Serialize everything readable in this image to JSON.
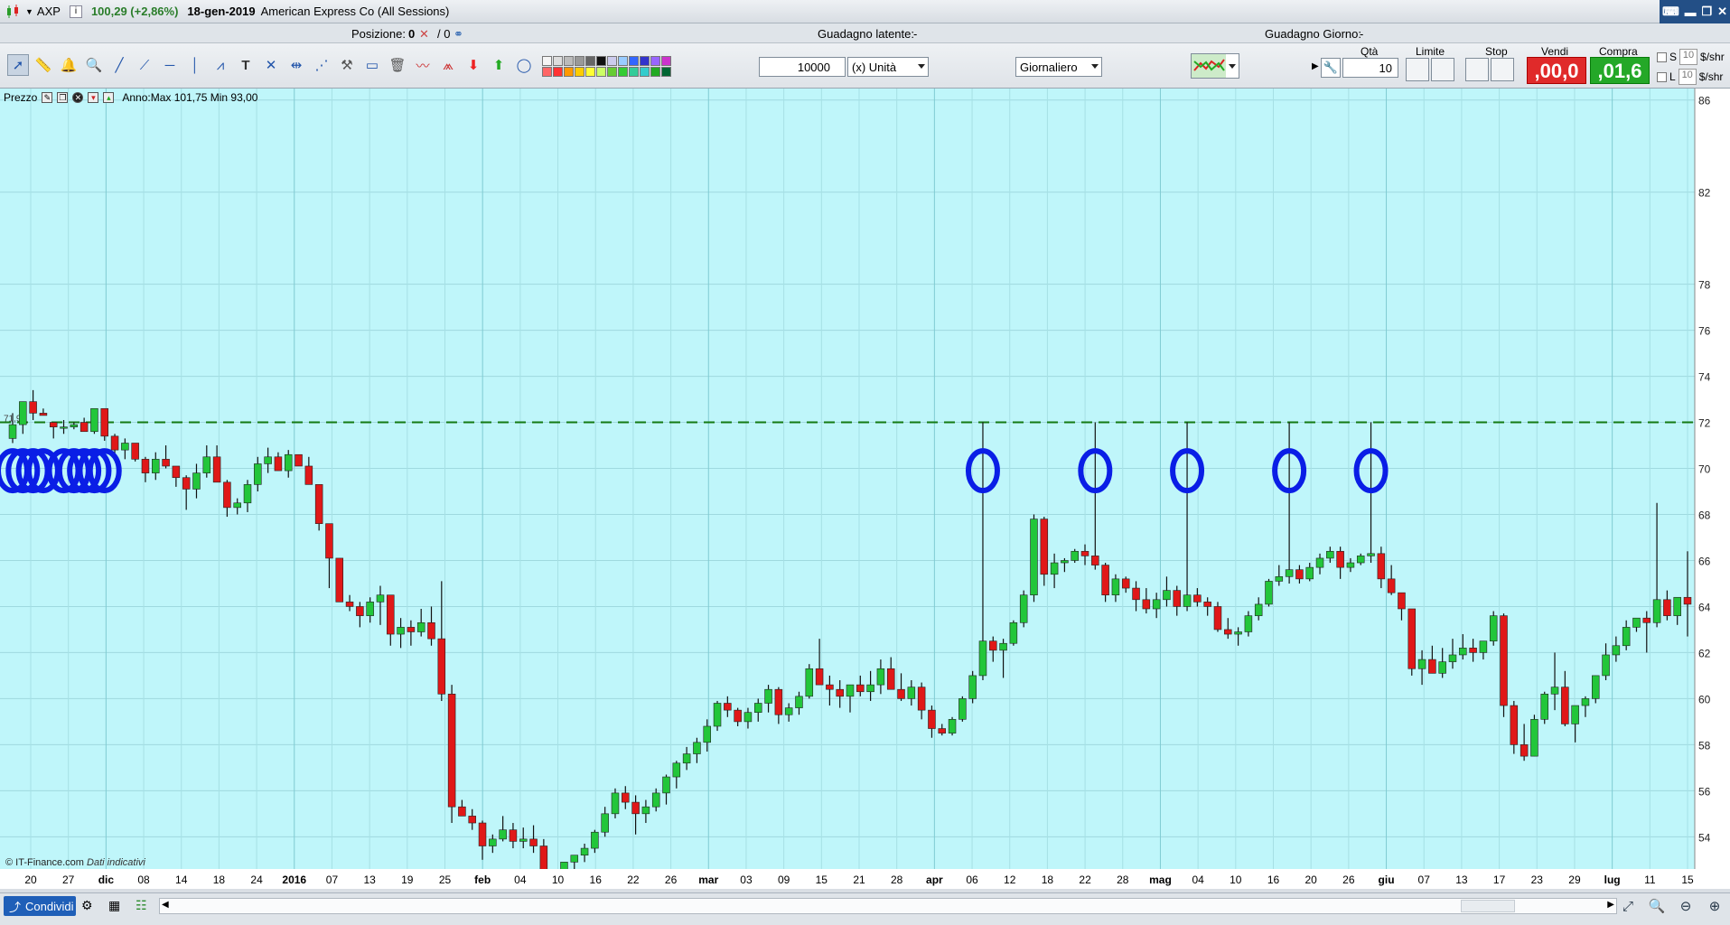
{
  "titlebar": {
    "symbol": "AXP",
    "info": "i",
    "price": "100,29 (+2,86%)",
    "date": "18-gen-2019",
    "name": "American Express Co (All Sessions)"
  },
  "status": {
    "position_label": "Posizione:",
    "position_value": "0",
    "position_ratio": "/ 0",
    "latent_label": "Guadagno latente:",
    "latent_value": "-",
    "day_label": "Guadagno Giorno:",
    "day_value": "-"
  },
  "toolbar": {
    "quantity": "10000",
    "unit": "(x) Unità",
    "period": "Giornaliero"
  },
  "trade": {
    "qty_label": "Qtà",
    "qty_value": "10",
    "limit_label": "Limite",
    "stop_label": "Stop",
    "sell_label": "Vendi",
    "sell_price": ",00,0",
    "buy_label": "Compra",
    "buy_price": ",01,6",
    "s_label": "S",
    "l_label": "L",
    "s_value": "10",
    "l_value": "10",
    "unit_s": "$/shr",
    "unit_l": "$/shr"
  },
  "chart_header": {
    "label": "Prezzo",
    "stats": "Anno:Max 101,75 Min 93,00",
    "level_tag": "71,97"
  },
  "footer": {
    "copyright": "© IT-Finance.com",
    "note": "Dati indicativi",
    "share": "Condividi"
  },
  "colors": {
    "background": "#bff6fa",
    "up": "#22c63a",
    "down": "#e01818",
    "annotation": "#0a1ee6",
    "resistance": "#137a13"
  },
  "chart_data": {
    "type": "candlestick",
    "ylim": [
      52.6,
      86.5
    ],
    "yticks": [
      86,
      82,
      78,
      76,
      74,
      72,
      70,
      68,
      66,
      64,
      62,
      60,
      58,
      56,
      54
    ],
    "x_labels": [
      "20",
      "27",
      "dic",
      "08",
      "14",
      "18",
      "24",
      "2016",
      "07",
      "13",
      "19",
      "25",
      "feb",
      "04",
      "10",
      "16",
      "22",
      "26",
      "mar",
      "03",
      "09",
      "15",
      "21",
      "28",
      "apr",
      "06",
      "12",
      "18",
      "22",
      "28",
      "mag",
      "04",
      "10",
      "16",
      "20",
      "26",
      "giu",
      "07",
      "13",
      "17",
      "23",
      "29",
      "lug",
      "11",
      "15"
    ],
    "resistance_level": 72,
    "annotations": "blue hand-drawn circles marking wicks that touch resistance",
    "candles": [
      [
        71.3,
        72.4,
        71.1,
        71.9
      ],
      [
        71.9,
        72.8,
        71.5,
        72.9
      ],
      [
        72.9,
        73.4,
        72.1,
        72.4
      ],
      [
        72.4,
        72.6,
        72.3,
        72.3
      ],
      [
        72.0,
        71.9,
        71.3,
        71.8
      ],
      [
        71.8,
        72.1,
        71.5,
        71.8
      ],
      [
        71.8,
        72.0,
        71.7,
        71.9
      ],
      [
        72.0,
        72.2,
        71.8,
        71.6
      ],
      [
        71.6,
        72.5,
        71.5,
        72.6
      ],
      [
        72.6,
        72.6,
        71.2,
        71.4
      ],
      [
        71.4,
        71.5,
        70.4,
        70.8
      ],
      [
        70.8,
        71.3,
        70.4,
        71.1
      ],
      [
        71.1,
        71.1,
        70.3,
        70.4
      ],
      [
        70.4,
        70.5,
        69.4,
        69.8
      ],
      [
        69.8,
        70.7,
        69.5,
        70.4
      ],
      [
        70.4,
        71.0,
        70.0,
        70.1
      ],
      [
        70.1,
        70.1,
        69.2,
        69.6
      ],
      [
        69.6,
        69.7,
        68.2,
        69.1
      ],
      [
        69.1,
        70.2,
        68.7,
        69.8
      ],
      [
        69.8,
        71.0,
        69.6,
        70.5
      ],
      [
        70.5,
        71.0,
        69.6,
        69.4
      ],
      [
        69.4,
        69.5,
        67.9,
        68.3
      ],
      [
        68.3,
        68.7,
        68.0,
        68.5
      ],
      [
        68.5,
        69.5,
        68.1,
        69.3
      ],
      [
        69.3,
        70.5,
        69.0,
        70.2
      ],
      [
        70.2,
        70.9,
        69.8,
        70.5
      ],
      [
        70.5,
        70.7,
        69.9,
        69.9
      ],
      [
        69.9,
        70.8,
        69.6,
        70.6
      ],
      [
        70.6,
        70.6,
        70.2,
        70.1
      ],
      [
        70.1,
        70.5,
        69.8,
        69.3
      ],
      [
        69.3,
        69.3,
        67.3,
        67.6
      ],
      [
        67.6,
        67.4,
        64.8,
        66.1
      ],
      [
        66.1,
        66.1,
        64.5,
        64.2
      ],
      [
        64.2,
        64.5,
        63.8,
        64.0
      ],
      [
        64.0,
        64.2,
        63.1,
        63.6
      ],
      [
        63.6,
        64.4,
        63.3,
        64.2
      ],
      [
        64.2,
        64.9,
        63.2,
        64.5
      ],
      [
        64.5,
        64.4,
        62.3,
        62.8
      ],
      [
        62.8,
        63.5,
        62.2,
        63.1
      ],
      [
        63.1,
        63.4,
        62.3,
        62.9
      ],
      [
        62.9,
        63.9,
        62.7,
        63.3
      ],
      [
        63.3,
        64.0,
        62.3,
        62.6
      ],
      [
        62.6,
        65.1,
        59.9,
        60.2
      ],
      [
        60.2,
        60.6,
        54.6,
        55.3
      ],
      [
        55.3,
        55.6,
        55.0,
        54.9
      ],
      [
        54.9,
        55.2,
        54.3,
        54.6
      ],
      [
        54.6,
        54.7,
        53.0,
        53.6
      ],
      [
        53.6,
        54.1,
        53.3,
        53.9
      ],
      [
        53.9,
        54.9,
        53.8,
        54.3
      ],
      [
        54.3,
        54.6,
        53.5,
        53.8
      ],
      [
        53.8,
        54.4,
        53.5,
        53.9
      ],
      [
        53.9,
        54.5,
        53.3,
        53.6
      ],
      [
        53.6,
        53.9,
        51.9,
        52.4
      ],
      [
        52.4,
        52.6,
        51.6,
        52.2
      ],
      [
        52.2,
        52.9,
        52.1,
        52.9
      ],
      [
        52.9,
        53.2,
        52.0,
        53.2
      ],
      [
        53.2,
        53.7,
        52.9,
        53.5
      ],
      [
        53.5,
        54.3,
        53.3,
        54.2
      ],
      [
        54.2,
        55.3,
        54.0,
        55.0
      ],
      [
        55.0,
        56.1,
        54.8,
        55.9
      ],
      [
        55.9,
        56.2,
        55.2,
        55.5
      ],
      [
        55.5,
        55.8,
        54.1,
        55.0
      ],
      [
        55.0,
        55.6,
        54.6,
        55.3
      ],
      [
        55.3,
        56.1,
        55.1,
        55.9
      ],
      [
        55.9,
        56.7,
        55.4,
        56.6
      ],
      [
        56.6,
        57.3,
        56.1,
        57.2
      ],
      [
        57.2,
        57.9,
        56.9,
        57.6
      ],
      [
        57.6,
        58.3,
        57.2,
        58.1
      ],
      [
        58.1,
        59.1,
        57.7,
        58.8
      ],
      [
        58.8,
        59.9,
        58.6,
        59.8
      ],
      [
        59.8,
        60.1,
        59.2,
        59.5
      ],
      [
        59.5,
        59.6,
        58.8,
        59.0
      ],
      [
        59.0,
        59.6,
        58.7,
        59.4
      ],
      [
        59.4,
        60.0,
        59.0,
        59.8
      ],
      [
        59.8,
        60.6,
        59.4,
        60.4
      ],
      [
        60.4,
        60.5,
        58.9,
        59.3
      ],
      [
        59.3,
        59.8,
        59.0,
        59.6
      ],
      [
        59.6,
        60.3,
        59.3,
        60.1
      ],
      [
        60.1,
        61.5,
        60.0,
        61.3
      ],
      [
        61.3,
        62.6,
        60.8,
        60.6
      ],
      [
        60.6,
        61.0,
        59.7,
        60.4
      ],
      [
        60.4,
        60.8,
        59.6,
        60.1
      ],
      [
        60.1,
        60.6,
        59.4,
        60.6
      ],
      [
        60.6,
        61.0,
        60.1,
        60.3
      ],
      [
        60.3,
        61.2,
        59.9,
        60.6
      ],
      [
        60.6,
        61.7,
        60.2,
        61.3
      ],
      [
        61.3,
        61.8,
        60.7,
        60.4
      ],
      [
        60.4,
        61.1,
        59.9,
        60.0
      ],
      [
        60.0,
        60.8,
        59.7,
        60.5
      ],
      [
        60.5,
        60.7,
        59.1,
        59.5
      ],
      [
        59.5,
        59.7,
        58.3,
        58.7
      ],
      [
        58.7,
        58.9,
        58.4,
        58.5
      ],
      [
        58.5,
        59.2,
        58.4,
        59.1
      ],
      [
        59.1,
        60.1,
        59.0,
        60.0
      ],
      [
        60.0,
        61.2,
        59.8,
        61.0
      ],
      [
        61.0,
        72.0,
        60.8,
        62.5
      ],
      [
        62.5,
        62.7,
        61.6,
        62.1
      ],
      [
        62.1,
        62.6,
        60.9,
        62.4
      ],
      [
        62.4,
        63.4,
        62.3,
        63.3
      ],
      [
        63.3,
        64.7,
        63.1,
        64.5
      ],
      [
        64.5,
        68.0,
        64.2,
        67.8
      ],
      [
        67.8,
        67.9,
        64.9,
        65.4
      ],
      [
        65.4,
        66.3,
        64.8,
        65.9
      ],
      [
        65.9,
        66.1,
        65.5,
        66.0
      ],
      [
        66.0,
        66.5,
        65.9,
        66.4
      ],
      [
        66.4,
        66.7,
        65.8,
        66.2
      ],
      [
        66.2,
        72.0,
        65.6,
        65.8
      ],
      [
        65.8,
        65.9,
        64.2,
        64.5
      ],
      [
        64.5,
        65.4,
        64.2,
        65.2
      ],
      [
        65.2,
        65.3,
        64.6,
        64.8
      ],
      [
        64.8,
        65.1,
        63.8,
        64.3
      ],
      [
        64.3,
        64.8,
        63.7,
        63.9
      ],
      [
        63.9,
        64.6,
        63.5,
        64.3
      ],
      [
        64.3,
        65.3,
        64.0,
        64.7
      ],
      [
        64.7,
        64.9,
        63.6,
        64.0
      ],
      [
        64.0,
        72.0,
        63.8,
        64.5
      ],
      [
        64.5,
        64.8,
        64.0,
        64.2
      ],
      [
        64.2,
        64.4,
        63.6,
        64.0
      ],
      [
        64.0,
        64.2,
        62.9,
        63.0
      ],
      [
        63.0,
        63.5,
        62.6,
        62.8
      ],
      [
        62.8,
        63.1,
        62.3,
        62.9
      ],
      [
        62.9,
        63.8,
        62.7,
        63.6
      ],
      [
        63.6,
        64.4,
        63.4,
        64.1
      ],
      [
        64.1,
        65.2,
        64.0,
        65.1
      ],
      [
        65.1,
        65.8,
        64.9,
        65.3
      ],
      [
        65.3,
        72.0,
        65.0,
        65.6
      ],
      [
        65.6,
        65.8,
        65.0,
        65.2
      ],
      [
        65.2,
        65.9,
        65.1,
        65.7
      ],
      [
        65.7,
        66.3,
        65.4,
        66.1
      ],
      [
        66.1,
        66.6,
        65.9,
        66.4
      ],
      [
        66.4,
        66.6,
        65.2,
        65.7
      ],
      [
        65.7,
        66.1,
        65.5,
        65.9
      ],
      [
        65.9,
        66.3,
        65.8,
        66.2
      ],
      [
        66.2,
        72.0,
        65.9,
        66.3
      ],
      [
        66.3,
        66.6,
        64.8,
        65.2
      ],
      [
        65.2,
        65.8,
        64.5,
        64.6
      ],
      [
        64.6,
        64.6,
        63.4,
        63.9
      ],
      [
        63.9,
        63.7,
        61.0,
        61.3
      ],
      [
        61.3,
        62.1,
        60.6,
        61.7
      ],
      [
        61.7,
        62.3,
        61.2,
        61.1
      ],
      [
        61.1,
        62.2,
        60.9,
        61.6
      ],
      [
        61.6,
        62.6,
        61.3,
        61.9
      ],
      [
        61.9,
        62.8,
        61.7,
        62.2
      ],
      [
        62.2,
        62.6,
        61.6,
        62.0
      ],
      [
        62.0,
        62.5,
        61.7,
        62.5
      ],
      [
        62.5,
        63.8,
        62.3,
        63.6
      ],
      [
        63.6,
        63.7,
        59.2,
        59.7
      ],
      [
        59.7,
        59.9,
        57.6,
        58.0
      ],
      [
        58.0,
        58.9,
        57.3,
        57.5
      ],
      [
        57.5,
        59.3,
        57.8,
        59.1
      ],
      [
        59.1,
        60.3,
        58.9,
        60.2
      ],
      [
        60.2,
        62.0,
        59.5,
        60.5
      ],
      [
        60.5,
        61.2,
        58.8,
        58.9
      ],
      [
        58.9,
        59.3,
        58.1,
        59.7
      ],
      [
        59.7,
        60.1,
        59.2,
        60.0
      ],
      [
        60.0,
        60.4,
        59.8,
        61.0
      ],
      [
        61.0,
        62.4,
        60.8,
        61.9
      ],
      [
        61.9,
        62.7,
        61.6,
        62.3
      ],
      [
        62.3,
        63.4,
        62.1,
        63.1
      ],
      [
        63.1,
        63.4,
        62.9,
        63.5
      ],
      [
        63.5,
        63.8,
        62.0,
        63.3
      ],
      [
        63.3,
        68.5,
        63.1,
        64.3
      ],
      [
        64.3,
        64.7,
        63.4,
        63.6
      ],
      [
        63.6,
        64.3,
        63.2,
        64.4
      ],
      [
        64.4,
        66.4,
        62.7,
        64.1
      ]
    ]
  }
}
